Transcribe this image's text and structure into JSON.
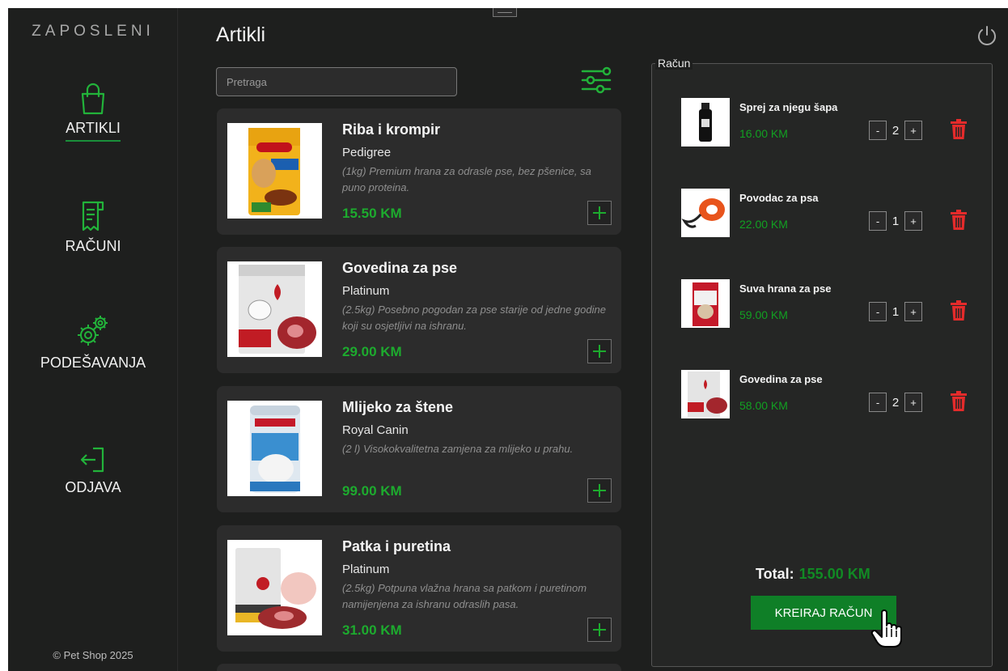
{
  "sidebar": {
    "brand": "ZAPOSLENI",
    "items": [
      {
        "label": "ARTIKLI",
        "active": true
      },
      {
        "label": "RAČUNI",
        "active": false
      },
      {
        "label": "PODEŠAVANJA",
        "active": false
      },
      {
        "label": "ODJAVA",
        "active": false
      }
    ],
    "copyright": "© Pet Shop 2025"
  },
  "header": {
    "title": "Artikli"
  },
  "search": {
    "placeholder": "Pretraga",
    "value": ""
  },
  "products": [
    {
      "name": "Riba i krompir",
      "brand": "Pedigree",
      "description": "(1kg) Premium hrana za odrasle pse, bez pšenice, sa puno proteina.",
      "price": "15.50 KM"
    },
    {
      "name": "Govedina za pse",
      "brand": "Platinum",
      "description": "(2.5kg) Posebno pogodan za pse starije od jedne godine koji su osjetljivi na ishranu.",
      "price": "29.00 KM"
    },
    {
      "name": "Mlijeko za štene",
      "brand": "Royal Canin",
      "description": "(2 l) Visokokvalitetna zamjena za mlijeko u prahu.",
      "price": "99.00 KM"
    },
    {
      "name": "Patka i puretina",
      "brand": "Platinum",
      "description": "(2.5kg)  Potpuna vlažna hrana sa patkom i puretinom namijenjena za ishranu odraslih pasa.",
      "price": "31.00 KM"
    }
  ],
  "bill": {
    "legend": "Račun",
    "items": [
      {
        "name": "Sprej za njegu šapa",
        "price": "16.00 KM",
        "qty": "2"
      },
      {
        "name": "Povodac za psa",
        "price": "22.00 KM",
        "qty": "1"
      },
      {
        "name": "Suva hrana za pse",
        "price": "59.00 KM",
        "qty": "1"
      },
      {
        "name": "Govedina za pse",
        "price": "58.00 KM",
        "qty": "2"
      }
    ],
    "minus_label": "-",
    "plus_label": "+",
    "total_label": "Total:",
    "total_value": "155.00 KM",
    "create_label": "KREIRAJ RAČUN"
  },
  "colors": {
    "accent": "#1dab2e",
    "danger": "#e52b2b",
    "background": "#1e1f1e",
    "card": "#2c2c2c"
  }
}
